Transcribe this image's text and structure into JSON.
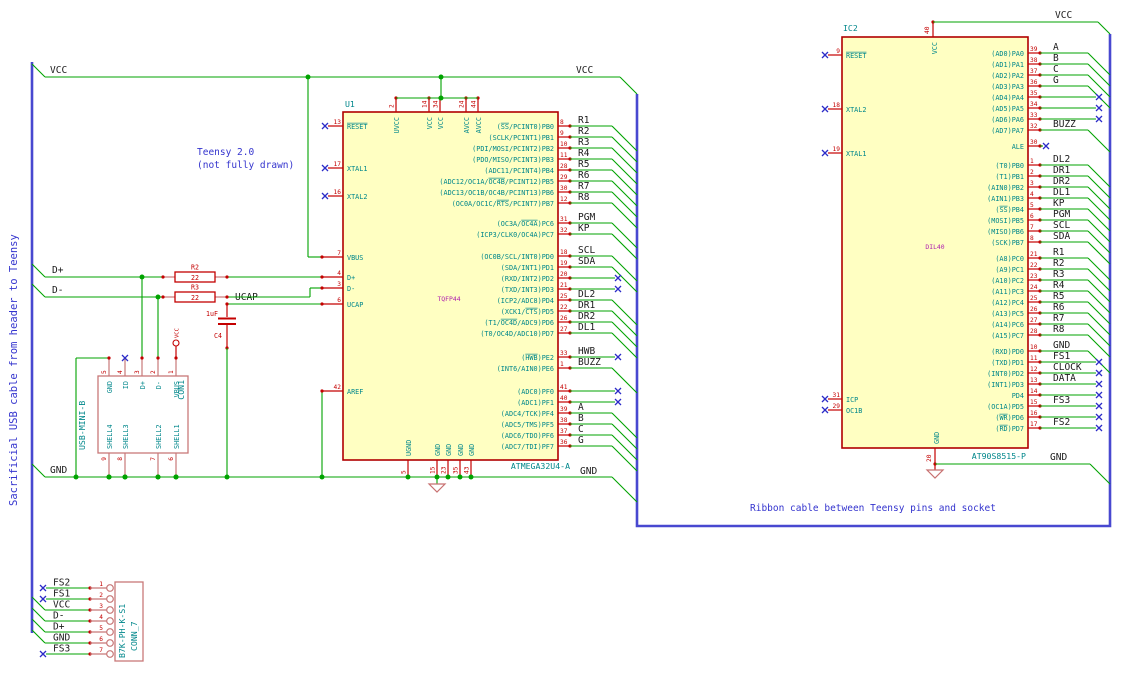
{
  "notes": {
    "teensy_line1": "Teensy 2.0",
    "teensy_line2": "(not fully drawn)",
    "ribbon": "Ribbon cable between Teensy pins and socket",
    "usb_cable": "Sacrificial USB cable from header to Teensy"
  },
  "labels": {
    "vcc": "VCC",
    "gnd": "GND",
    "dplus": "D+",
    "dminus": "D-",
    "ucap": "UCAP"
  },
  "colors": {
    "wire": "#00A300",
    "bus": "#4848D0",
    "symbol": "#C40000",
    "connector": "#C87878",
    "body_fill": "#FFFFC2",
    "pin_name": "#00878B",
    "note": "#3434CE",
    "net_label": "#1A1A1A",
    "no_connect": "#2B2BC8",
    "footprint": "#AF20AF"
  },
  "u1": {
    "ref": "U1",
    "value": "ATMEGA32U4-A",
    "footprint": "TQFP44",
    "top_pins": [
      {
        "num": "2",
        "name": "UVCC"
      },
      {
        "num": "14",
        "name": "VCC"
      },
      {
        "num": "34",
        "name": "VCC"
      },
      {
        "num": "24",
        "name": "AVCC"
      },
      {
        "num": "44",
        "name": "AVCC"
      }
    ],
    "bottom_pins": [
      {
        "num": "5",
        "name": "UGND"
      },
      {
        "num": "15",
        "name": "GND"
      },
      {
        "num": "23",
        "name": "GND"
      },
      {
        "num": "35",
        "name": "GND"
      },
      {
        "num": "43",
        "name": "GND"
      }
    ],
    "left_pins": [
      {
        "num": "13",
        "name": "~RESET~",
        "nc": true
      },
      {
        "num": "17",
        "name": "XTAL1",
        "nc": true
      },
      {
        "num": "16",
        "name": "XTAL2",
        "nc": true
      },
      {
        "num": "7",
        "name": "VBUS"
      },
      {
        "num": "4",
        "name": "D+"
      },
      {
        "num": "3",
        "name": "D-"
      },
      {
        "num": "6",
        "name": "UCAP"
      },
      {
        "num": "42",
        "name": "AREF"
      }
    ],
    "right_pins": [
      {
        "num": "8",
        "name": "(~SS~/PCINT0)PB0",
        "label": "R1",
        "conn": "bus"
      },
      {
        "num": "9",
        "name": "(SCLK/PCINT1)PB1",
        "label": "R2",
        "conn": "bus"
      },
      {
        "num": "10",
        "name": "(PDI/MOSI/PCINT2)PB2",
        "label": "R3",
        "conn": "bus"
      },
      {
        "num": "11",
        "name": "(PDO/MISO/PCINT3)PB3",
        "label": "R4",
        "conn": "bus"
      },
      {
        "num": "28",
        "name": "(ADC11/PCINT4)PB4",
        "label": "R5",
        "conn": "bus"
      },
      {
        "num": "29",
        "name": "(ADC12/OC1A/~OC4B~/PCINT12)PB5",
        "label": "R6",
        "conn": "bus"
      },
      {
        "num": "30",
        "name": "(ADC13/OC1B/OC4B/PCINT13)PB6",
        "label": "R7",
        "conn": "bus"
      },
      {
        "num": "12",
        "name": "(OC0A/OC1C/~RTS~/PCINT7)PB7",
        "label": "R8",
        "conn": "bus"
      },
      {
        "num": "31",
        "name": "(OC3A/~OC4A~)PC6",
        "label": "PGM",
        "conn": "bus"
      },
      {
        "num": "32",
        "name": "(ICP3/CLK0/OC4A)PC7",
        "label": "KP",
        "conn": "bus"
      },
      {
        "num": "18",
        "name": "(OC0B/SCL/INT0)PD0",
        "label": "SCL",
        "conn": "bus"
      },
      {
        "num": "19",
        "name": "(SDA/INT1)PD1",
        "label": "SDA",
        "conn": "bus"
      },
      {
        "num": "20",
        "name": "(RXD/INT2)PD2",
        "label": "",
        "conn": "nc"
      },
      {
        "num": "21",
        "name": "(TXD/INT3)PD3",
        "label": "",
        "conn": "nc"
      },
      {
        "num": "25",
        "name": "(ICP2/ADC8)PD4",
        "label": "DL2",
        "conn": "bus"
      },
      {
        "num": "22",
        "name": "(XCK1/~CTS~)PD5",
        "label": "DR1",
        "conn": "bus"
      },
      {
        "num": "26",
        "name": "(T1/~OC4D~/ADC9)PD6",
        "label": "DR2",
        "conn": "bus"
      },
      {
        "num": "27",
        "name": "(T0/OC4D/ADC10)PD7",
        "label": "DL1",
        "conn": "bus"
      },
      {
        "num": "33",
        "name": "(~HWB~)PE2",
        "label": "HWB",
        "conn": "nc"
      },
      {
        "num": "1",
        "name": "(INT6/AIN0)PE6",
        "label": "BUZZ",
        "conn": "bus"
      },
      {
        "num": "41",
        "name": "(ADC0)PF0",
        "label": "",
        "conn": "nc"
      },
      {
        "num": "40",
        "name": "(ADC1)PF1",
        "label": "",
        "conn": "nc"
      },
      {
        "num": "39",
        "name": "(ADC4/TCK)PF4",
        "label": "A",
        "conn": "bus"
      },
      {
        "num": "38",
        "name": "(ADC5/TMS)PF5",
        "label": "B",
        "conn": "bus"
      },
      {
        "num": "37",
        "name": "(ADC6/TDO)PF6",
        "label": "C",
        "conn": "bus"
      },
      {
        "num": "36",
        "name": "(ADC7/TDI)PF7",
        "label": "G",
        "conn": "bus"
      }
    ]
  },
  "ic2": {
    "ref": "IC2",
    "value": "AT90S8515-P",
    "footprint": "DIL40",
    "top_pins": [
      {
        "num": "40",
        "name": "VCC"
      }
    ],
    "bottom_pins": [
      {
        "num": "20",
        "name": "GND"
      }
    ],
    "left_pins": [
      {
        "num": "9",
        "name": "~RESET~",
        "nc": true
      },
      {
        "num": "18",
        "name": "XTAL2",
        "nc": true
      },
      {
        "num": "19",
        "name": "XTAL1",
        "nc": true
      },
      {
        "num": "31",
        "name": "ICP",
        "nc": true
      },
      {
        "num": "29",
        "name": "OC1B",
        "nc": true
      }
    ],
    "right_pins": [
      {
        "num": "39",
        "name": "(AD0)PA0",
        "label": "A",
        "conn": "bus"
      },
      {
        "num": "38",
        "name": "(AD1)PA1",
        "label": "B",
        "conn": "bus"
      },
      {
        "num": "37",
        "name": "(AD2)PA2",
        "label": "C",
        "conn": "bus"
      },
      {
        "num": "36",
        "name": "(AD3)PA3",
        "label": "G",
        "conn": "bus"
      },
      {
        "num": "35",
        "name": "(AD4)PA4",
        "label": "",
        "conn": "ncfar"
      },
      {
        "num": "34",
        "name": "(AD5)PA5",
        "label": "",
        "conn": "ncfar"
      },
      {
        "num": "33",
        "name": "(AD6)PA6",
        "label": "",
        "conn": "ncfar"
      },
      {
        "num": "32",
        "name": "(AD7)PA7",
        "label": "BUZZ",
        "conn": "bus"
      },
      {
        "num": "30",
        "name": "ALE",
        "label": "",
        "conn": "ncshort"
      },
      {
        "num": "1",
        "name": "(T0)PB0",
        "label": "DL2",
        "conn": "bus"
      },
      {
        "num": "2",
        "name": "(T1)PB1",
        "label": "DR1",
        "conn": "bus"
      },
      {
        "num": "3",
        "name": "(AIN0)PB2",
        "label": "DR2",
        "conn": "bus"
      },
      {
        "num": "4",
        "name": "(AIN1)PB3",
        "label": "DL1",
        "conn": "bus"
      },
      {
        "num": "5",
        "name": "(~SS~)PB4",
        "label": "KP",
        "conn": "bus"
      },
      {
        "num": "6",
        "name": "(MOSI)PB5",
        "label": "PGM",
        "conn": "bus"
      },
      {
        "num": "7",
        "name": "(MISO)PB6",
        "label": "SCL",
        "conn": "bus"
      },
      {
        "num": "8",
        "name": "(SCK)PB7",
        "label": "SDA",
        "conn": "bus"
      },
      {
        "num": "21",
        "name": "(A8)PC0",
        "label": "R1",
        "conn": "bus"
      },
      {
        "num": "22",
        "name": "(A9)PC1",
        "label": "R2",
        "conn": "bus"
      },
      {
        "num": "23",
        "name": "(A10)PC2",
        "label": "R3",
        "conn": "bus"
      },
      {
        "num": "24",
        "name": "(A11)PC3",
        "label": "R4",
        "conn": "bus"
      },
      {
        "num": "25",
        "name": "(A12)PC4",
        "label": "R5",
        "conn": "bus"
      },
      {
        "num": "26",
        "name": "(A13)PC5",
        "label": "R6",
        "conn": "bus"
      },
      {
        "num": "27",
        "name": "(A14)PC6",
        "label": "R7",
        "conn": "bus"
      },
      {
        "num": "28",
        "name": "(A15)PC7",
        "label": "R8",
        "conn": "bus"
      },
      {
        "num": "10",
        "name": "(RXD)PD0",
        "label": "GND",
        "conn": "bus"
      },
      {
        "num": "11",
        "name": "(TXD)PD1",
        "label": "FS1",
        "conn": "ncfar"
      },
      {
        "num": "12",
        "name": "(INT0)PD2",
        "label": "CLOCK",
        "conn": "ncfar"
      },
      {
        "num": "13",
        "name": "(INT1)PD3",
        "label": "DATA",
        "conn": "ncfar"
      },
      {
        "num": "14",
        "name": "PD4",
        "label": "",
        "conn": "ncfar"
      },
      {
        "num": "15",
        "name": "(OC1A)PD5",
        "label": "FS3",
        "conn": "ncfar"
      },
      {
        "num": "16",
        "name": "(~WR~)PD6",
        "label": "",
        "conn": "ncfar"
      },
      {
        "num": "17",
        "name": "(~RD~)PD7",
        "label": "FS2",
        "conn": "ncfar"
      }
    ]
  },
  "con1": {
    "ref": "CON1",
    "value": "USB-MINI-B",
    "top_pins": [
      {
        "num": "5",
        "name": "GND"
      },
      {
        "num": "4",
        "name": "ID",
        "nc": true
      },
      {
        "num": "3",
        "name": "D+"
      },
      {
        "num": "2",
        "name": "D-"
      },
      {
        "num": "1",
        "name": "VBUS"
      }
    ],
    "bottom_pins": [
      {
        "num": "9",
        "name": "SHELL4"
      },
      {
        "num": "8",
        "name": "SHELL3"
      },
      {
        "num": "7",
        "name": "SHELL2"
      },
      {
        "num": "6",
        "name": "SHELL1"
      }
    ]
  },
  "conn7": {
    "ref": "CONN_7",
    "value": "B7K-PH-K-S1",
    "pins": [
      {
        "num": "1",
        "label": "FS2",
        "nc": true
      },
      {
        "num": "2",
        "label": "FS1",
        "nc": true
      },
      {
        "num": "3",
        "label": "VCC",
        "nc": false
      },
      {
        "num": "4",
        "label": "D-",
        "nc": false
      },
      {
        "num": "5",
        "label": "D+",
        "nc": false
      },
      {
        "num": "6",
        "label": "GND",
        "nc": false
      },
      {
        "num": "7",
        "label": "FS3",
        "nc": true
      }
    ]
  },
  "r2": {
    "ref": "R2",
    "value": "22"
  },
  "r3": {
    "ref": "R3",
    "value": "22"
  },
  "c4": {
    "ref": "C4",
    "value": "1uF"
  }
}
